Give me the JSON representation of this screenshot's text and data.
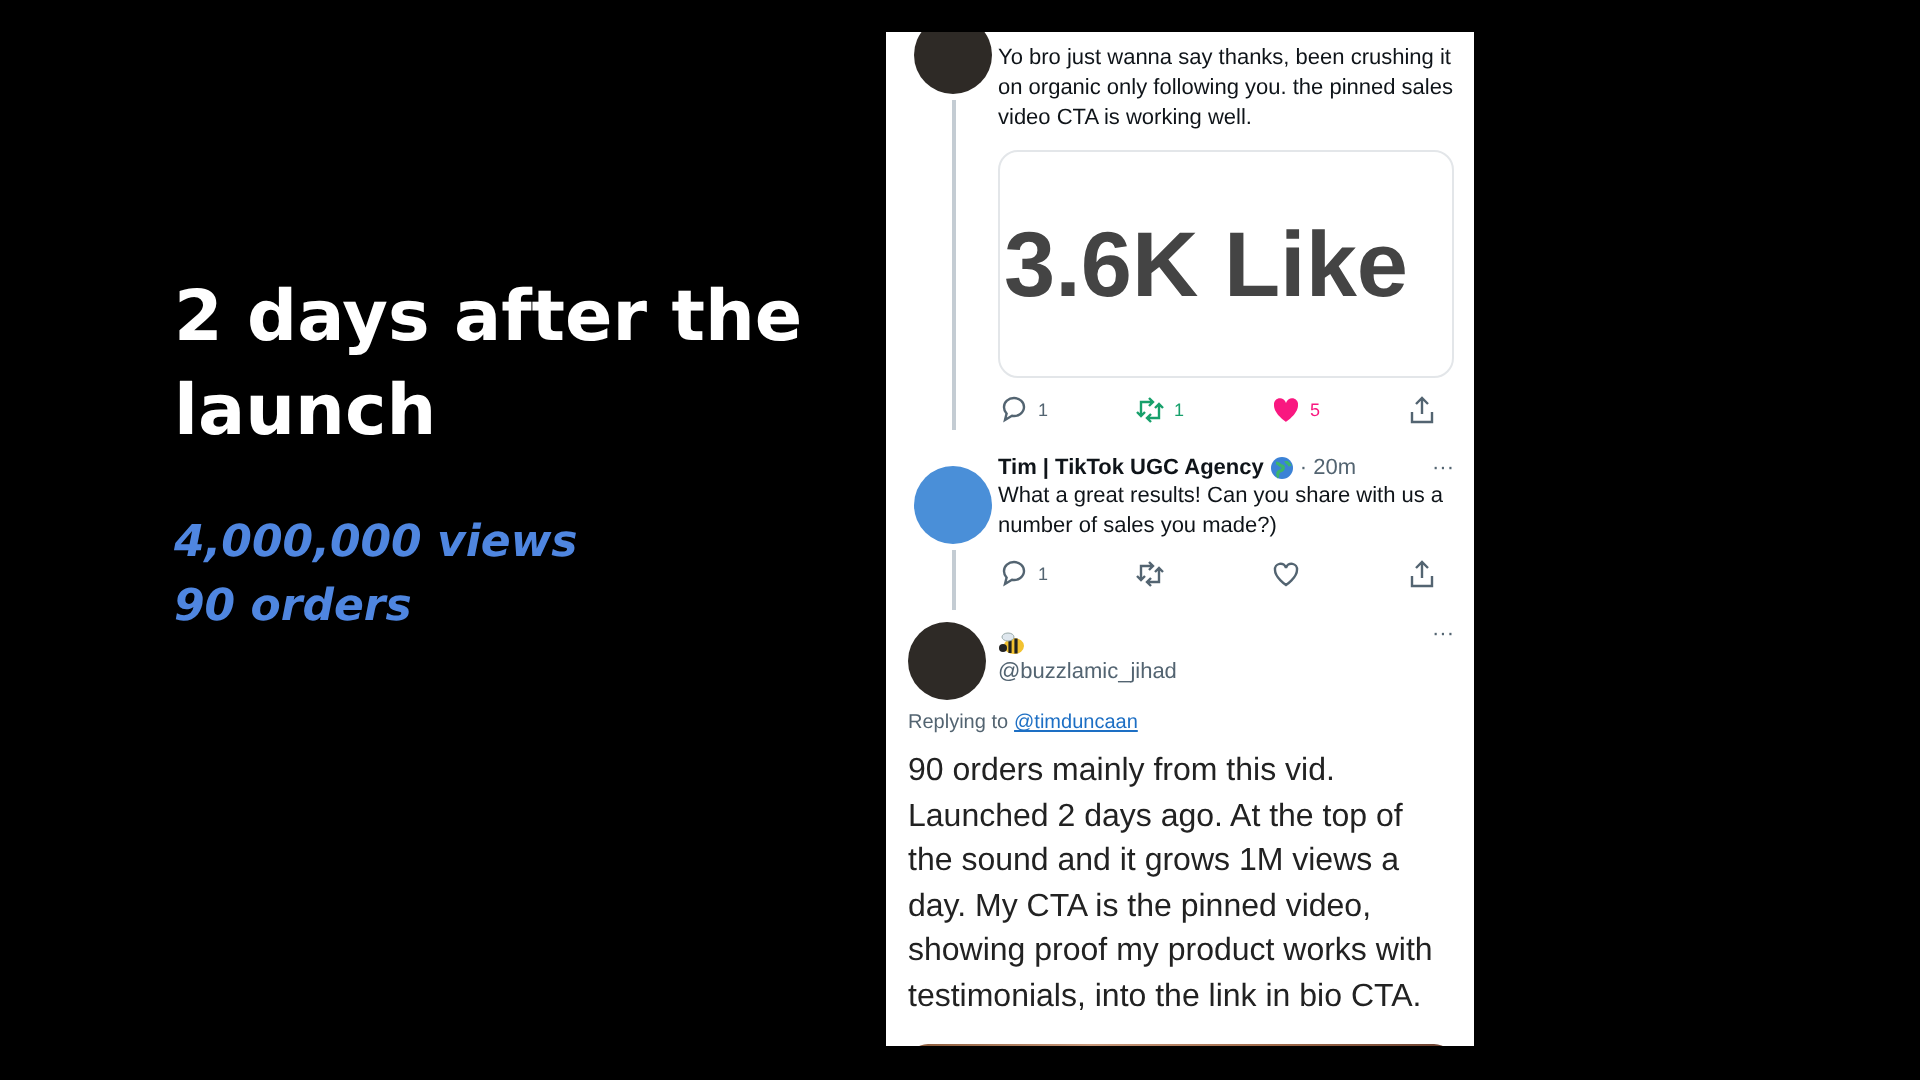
{
  "slide": {
    "title": "2 days after the launch",
    "stats": [
      "4,000,000 views",
      "90 orders"
    ]
  },
  "thread": [
    {
      "kind": "parent",
      "text": "Yo bro just wanna say thanks, been crushing it on organic only following you. the pinned sales video CTA is working well.",
      "media_text": "3.6K Like",
      "actions": {
        "reply": "1",
        "retweet": "1",
        "like": "5",
        "liked": true
      }
    },
    {
      "kind": "reply",
      "name": "Tim | TikTok UGC Agency",
      "time": "· 20m",
      "more": "···",
      "text": "What a great results! Can you share with us a number of sales you made?)",
      "actions": {
        "reply": "1",
        "liked": false
      }
    },
    {
      "kind": "focused",
      "handle": "@buzzlamic_jihad",
      "more": "···",
      "replying_label": "Replying to",
      "replying_to": "@timduncaan",
      "text": "90 orders mainly from this vid. Launched 2 days ago. At the top of the sound and it grows 1M views a day. My CTA is the pinned video, showing proof my product works with testimonials, into the link in bio CTA."
    }
  ]
}
